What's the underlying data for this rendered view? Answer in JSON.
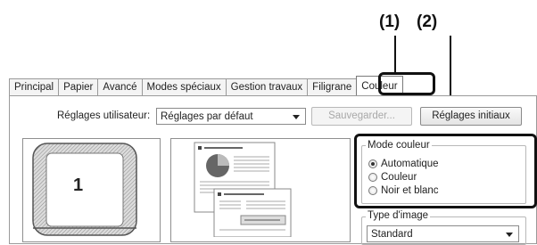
{
  "callouts": {
    "one": "(1)",
    "two": "(2)"
  },
  "tabs": [
    {
      "label": "Principal"
    },
    {
      "label": "Papier"
    },
    {
      "label": "Avancé"
    },
    {
      "label": "Modes spéciaux"
    },
    {
      "label": "Gestion travaux"
    },
    {
      "label": "Filigrane"
    },
    {
      "label": "Couleur",
      "active": true
    }
  ],
  "settings": {
    "user_settings_label": "Réglages utilisateur:",
    "user_settings_value": "Réglages par défaut",
    "save_label": "Sauvegarder...",
    "initial_label": "Réglages initiaux"
  },
  "preview": {
    "copies_number": "1",
    "doc_title": "The Effect of Interface Forms",
    "doc_heading2": "Communication Effects"
  },
  "color_mode": {
    "title": "Mode couleur",
    "options": [
      {
        "label": "Automatique",
        "checked": true
      },
      {
        "label": "Couleur",
        "checked": false
      },
      {
        "label": "Noir et blanc",
        "checked": false
      }
    ]
  },
  "image_type": {
    "title": "Type d'image",
    "value": "Standard"
  },
  "colors": {
    "highlight": "#111111",
    "frame": "#9a9a9a"
  }
}
